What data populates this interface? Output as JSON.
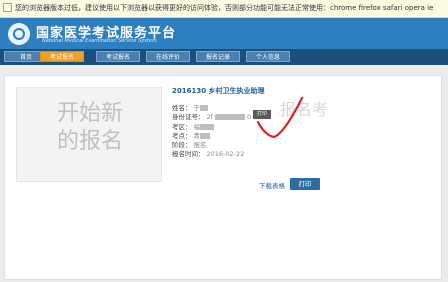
{
  "notice_bar": {
    "text": "您的浏览器版本过低，建议使用以下浏览器以获得更好的访问体验，否则部分功能可能无法正常使用：chrome firefox safari opera ie"
  },
  "header": {
    "title_cn": "国家医学考试服务平台",
    "title_en": "National Medical Examination Service System"
  },
  "nav": {
    "items": [
      "首页",
      "考试报名",
      "考试报名",
      "在线评价",
      "报名记录",
      "个人信息"
    ],
    "active_index": 1
  },
  "card": {
    "photo_placeholder_line1": "开始新",
    "photo_placeholder_line2": "的报名",
    "exam_title": "2016130 乡村卫生执业助理",
    "fields": {
      "name_label": "姓名：",
      "name_value": "于",
      "id_label": "身份证号：",
      "id_value": "2f",
      "id_value_tail": "0",
      "print_small": "打印",
      "region_label": "考区：",
      "region_value": "福",
      "point_label": "考点：",
      "point_value": "青",
      "stage_label": "阶段：",
      "stage_value": "报名",
      "time_label": "报名时间：",
      "time_value": "2016-02-22"
    },
    "watermark": "报名考",
    "download_link": "下载表格",
    "print_button": "打印"
  },
  "colors": {
    "header_blue": "#2e7fbf",
    "nav_dark": "#1c4f7b",
    "active_tab": "#f0a020",
    "annotation_red": "#e02020"
  }
}
